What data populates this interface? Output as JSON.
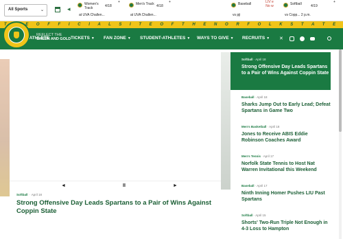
{
  "scorebar": {
    "sport_select": "All Sports",
    "games": [
      {
        "name": "Women's Track",
        "date": "4/18",
        "sub": "at UVA Challen..."
      },
      {
        "name": "Men's Track",
        "date": "4/18",
        "sub": "at UVA Challen..."
      },
      {
        "name": "Baseball",
        "date": "",
        "sub": "vs pji"
      },
      {
        "name": "Softball",
        "date": "4/19",
        "sub": "vs Copp... 2 p.m."
      }
    ],
    "listen_label": "LIV e No w"
  },
  "stripe_text": "T H E   O F F I C I A L   S I T E   O F   T H E   N O R F O L K   S T A T E   S P A R T A N S",
  "tagline": {
    "line1": "REFLECT THE",
    "line2": "GREEN AND GOLD"
  },
  "nav": {
    "items": [
      "TEAMS",
      "TICKETS",
      "FAN ZONE",
      "STUDENT-ATHLETES",
      "WAYS TO GIVE",
      "RECRUITS"
    ],
    "teams_prefix": "BE ATHLETE"
  },
  "hero": {
    "sport": "Softball",
    "date": "April 18",
    "title": "Strong Offensive Day Leads Spartans to a Pair of Wins Against Coppin State",
    "controls": {
      "prev": "◄",
      "pause": "II",
      "next": "►"
    }
  },
  "sidebar": {
    "news": [
      {
        "sport": "Softball",
        "date": "April 18",
        "title": "Strong Offensive Day Leads Spartans to a Pair of Wins Against Coppin State"
      },
      {
        "sport": "Baseball",
        "date": "April 18",
        "title": "Sharks Jump Out to Early Lead; Defeat Spartans in Game Two"
      },
      {
        "sport": "Men's Basketball",
        "date": "April 18",
        "title": "Jones to Receive ABIS Eddie Robinson Coaches Award"
      },
      {
        "sport": "Men's Tennis",
        "date": "April 17",
        "title": "Norfolk State Tennis to Host Nat Warren Invitational this Weekend"
      },
      {
        "sport": "Baseball",
        "date": "April 17",
        "title": "Ninth Inning Homer Pushes LIU Past Spartans"
      },
      {
        "sport": "Softball",
        "date": "April 15",
        "title": "Shorts' Two-Run Triple Not Enough in 4-3 Loss to Hampton"
      }
    ]
  },
  "colors": {
    "green": "#1a7a42",
    "gold": "#f0c419",
    "dark_green": "#1a5e34"
  }
}
